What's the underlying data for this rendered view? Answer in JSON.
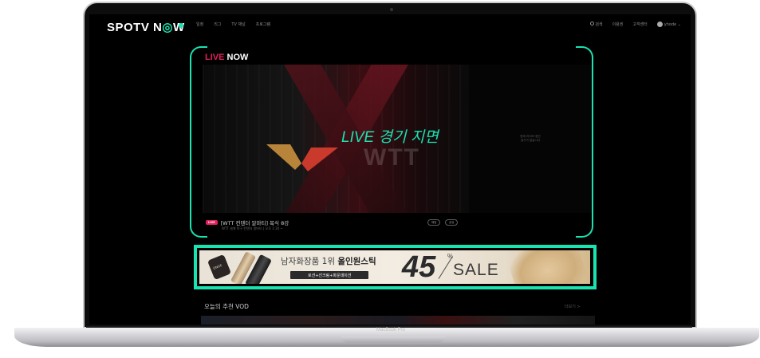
{
  "device": {
    "label": "MacBook Pro"
  },
  "nav": {
    "logo_prefix": "SPOTV N",
    "logo_o": "◎",
    "logo_suffix": "W",
    "items": [
      "일정",
      "리그",
      "TV 채널",
      "프로그램"
    ],
    "search_label": "검색",
    "voucher_label": "이용권",
    "support_label": "고객센터",
    "user_label": "yhode ⌄"
  },
  "live": {
    "title_live": "LIVE",
    "title_now": "NOW",
    "overlay_label": "LIVE 경기 지면",
    "player_logo_text": "WTT",
    "side_text_line1": "현재 라이브 중인",
    "side_text_line2": "경기가 없습니다",
    "badge": "LIVE",
    "match_title": "[WTT 컨텐더 알마티] 복식 8강",
    "match_sub": "WTT 세계 탁구 컨텐더 알마티 | 오후 1:30 ~",
    "chip_1": "채팅",
    "chip_2": "공유"
  },
  "banner": {
    "cap_brand": "ONGE",
    "headline_pre": "남자화장품 1위 ",
    "headline_bold": "올인원스틱",
    "sub": "로션+선크림+파운데이션",
    "discount": "45",
    "percent": "%",
    "sale": "SALE"
  },
  "vod": {
    "title": "오늘의 추천 VOD",
    "more": "더보기 >"
  },
  "colors": {
    "accent": "#19e3b1",
    "live_red": "#e0205c"
  }
}
